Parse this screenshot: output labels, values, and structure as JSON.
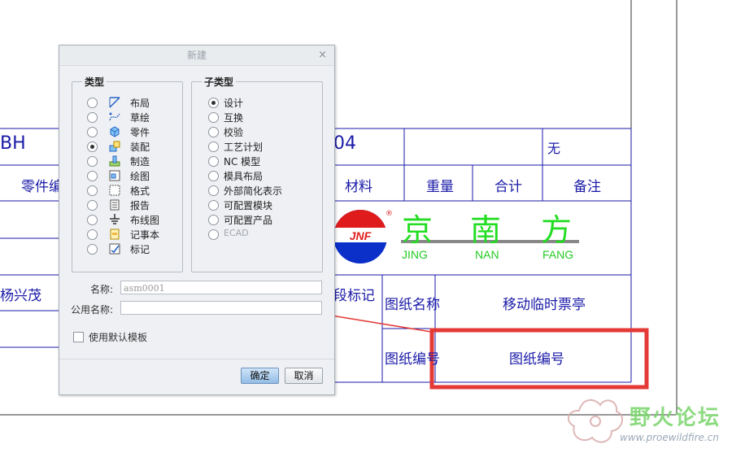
{
  "background": {
    "table": {
      "partial_left": "BH",
      "partial_mid": "04",
      "none_value": "无",
      "part_no_header": "零件编",
      "material_header": "材料",
      "weight_header": "重量",
      "total_header": "合计",
      "remarks_header": "备注",
      "designer": "杨兴茂",
      "stage_mark": "段标记",
      "drawing_name_label": "图纸名称",
      "drawing_name_value": "移动临时票亭",
      "drawing_no_label": "图纸编号",
      "drawing_no_value": "图纸编号"
    },
    "logo": {
      "mark": "JNF",
      "registered": "®",
      "char1": "京",
      "char2": "南",
      "char3": "方",
      "pinyin1": "JING",
      "pinyin2": "NAN",
      "pinyin3": "FANG"
    },
    "watermark": {
      "name": "野火论坛",
      "url": "www.proewildfire.cn"
    }
  },
  "dialog": {
    "title": "新建",
    "close": "×",
    "type_group": {
      "label": "类型",
      "items": [
        {
          "label": "布局",
          "icon": "layout-icon",
          "selected": false
        },
        {
          "label": "草绘",
          "icon": "sketch-icon",
          "selected": false
        },
        {
          "label": "零件",
          "icon": "part-icon",
          "selected": false
        },
        {
          "label": "装配",
          "icon": "assembly-icon",
          "selected": true
        },
        {
          "label": "制造",
          "icon": "manufacturing-icon",
          "selected": false
        },
        {
          "label": "绘图",
          "icon": "drawing-icon",
          "selected": false
        },
        {
          "label": "格式",
          "icon": "format-icon",
          "selected": false
        },
        {
          "label": "报告",
          "icon": "report-icon",
          "selected": false
        },
        {
          "label": "布线图",
          "icon": "diagram-icon",
          "selected": false
        },
        {
          "label": "记事本",
          "icon": "notebook-icon",
          "selected": false
        },
        {
          "label": "标记",
          "icon": "markup-icon",
          "selected": false
        }
      ]
    },
    "subtype_group": {
      "label": "子类型",
      "items": [
        {
          "label": "设计",
          "selected": true,
          "enabled": true
        },
        {
          "label": "互换",
          "selected": false,
          "enabled": true
        },
        {
          "label": "校验",
          "selected": false,
          "enabled": true
        },
        {
          "label": "工艺计划",
          "selected": false,
          "enabled": true
        },
        {
          "label": "NC 模型",
          "selected": false,
          "enabled": true
        },
        {
          "label": "模具布局",
          "selected": false,
          "enabled": true
        },
        {
          "label": "外部简化表示",
          "selected": false,
          "enabled": true
        },
        {
          "label": "可配置模块",
          "selected": false,
          "enabled": true
        },
        {
          "label": "可配置产品",
          "selected": false,
          "enabled": true
        },
        {
          "label": "ECAD",
          "selected": false,
          "enabled": false
        }
      ]
    },
    "name_label": "名称:",
    "name_value": "asm0001",
    "common_name_label": "公用名称:",
    "common_name_value": "",
    "use_default_template": "使用默认模板",
    "ok": "确定",
    "cancel": "取消"
  },
  "colors": {
    "cad_line": "#1a1aa8",
    "annotation_red": "#e53935",
    "logo_green": "#22dd22",
    "ok_button": "#93bde6"
  }
}
